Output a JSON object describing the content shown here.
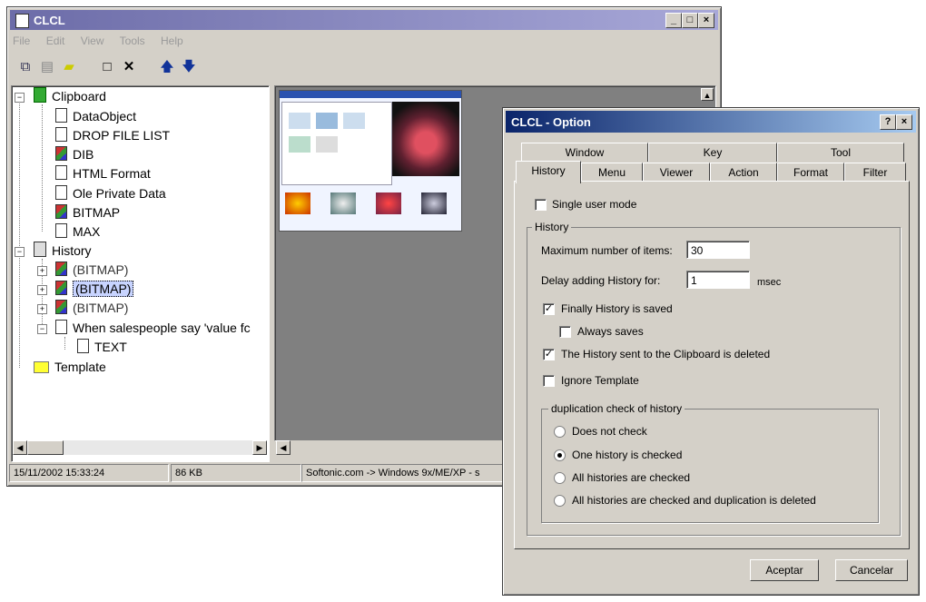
{
  "main_window": {
    "title": "CLCL",
    "menu": [
      "File",
      "Edit",
      "View",
      "Tools",
      "Help"
    ],
    "toolbar_icons": [
      "copy-icon",
      "paste-icon",
      "folder-icon",
      "new-document-icon",
      "delete-icon",
      "arrow-up-icon",
      "arrow-down-icon"
    ]
  },
  "tree": {
    "clipboard": "Clipboard",
    "clipboard_items": [
      "DataObject",
      "DROP FILE LIST",
      "DIB",
      "HTML Format",
      "Ole Private Data",
      "BITMAP",
      "MAX"
    ],
    "history": "History",
    "history_items": [
      "(BITMAP)",
      "(BITMAP)",
      "(BITMAP)",
      "When salespeople say 'value fc"
    ],
    "history_sub_item": "TEXT",
    "template": "Template"
  },
  "status": {
    "date": "15/11/2002 15:33:24",
    "size": "86 KB",
    "source": "Softonic.com -> Windows 9x/ME/XP - s"
  },
  "dialog": {
    "title": "CLCL - Option",
    "help_btn": "?",
    "close_btn": "×",
    "tabs_row1": [
      "Window",
      "Key",
      "Tool"
    ],
    "tabs_row2": [
      "History",
      "Menu",
      "Viewer",
      "Action",
      "Format",
      "Filter"
    ],
    "single_user_mode": "Single user mode",
    "history_group": "History",
    "max_items_label": "Maximum number of items:",
    "max_items_value": "30",
    "delay_label": "Delay adding History for:",
    "delay_value": "1",
    "delay_unit": "msec",
    "finally_saved": "Finally History is saved",
    "always_saves": "Always saves",
    "history_sent_deleted": "The History sent to the Clipboard is deleted",
    "ignore_template": "Ignore Template",
    "dup_group": "duplication check of history",
    "dup_options": [
      "Does not check",
      "One history is checked",
      "All histories are checked",
      "All histories are checked and duplication is deleted"
    ],
    "ok": "Aceptar",
    "cancel": "Cancelar"
  }
}
